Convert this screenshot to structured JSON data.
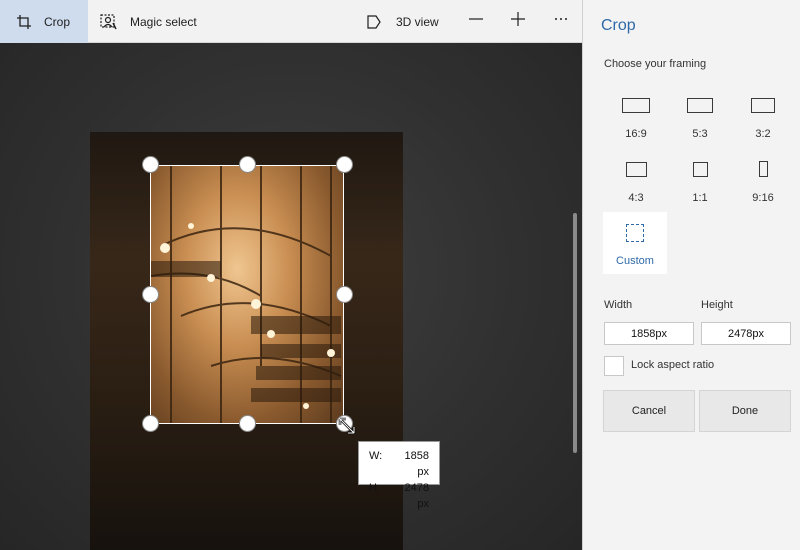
{
  "toolbar": {
    "crop_label": "Crop",
    "magic_select_label": "Magic select",
    "view_3d_label": "3D view",
    "zoom_out_icon": "minus-icon",
    "zoom_in_icon": "plus-icon",
    "more_icon": "ellipsis-icon"
  },
  "panel": {
    "title": "Crop",
    "subtitle": "Choose your framing",
    "ratios": [
      {
        "label": "16:9"
      },
      {
        "label": "5:3"
      },
      {
        "label": "3:2"
      },
      {
        "label": "4:3"
      },
      {
        "label": "1:1"
      },
      {
        "label": "9:16"
      }
    ],
    "custom_label": "Custom",
    "width_label": "Width",
    "height_label": "Height",
    "width_value": "1858px",
    "height_value": "2478px",
    "lock_label": "Lock aspect ratio",
    "cancel_label": "Cancel",
    "done_label": "Done"
  },
  "tooltip": {
    "w_key": "W:",
    "w_value": "1858 px",
    "h_key": "H:",
    "h_value": "2478 px"
  },
  "colors": {
    "accent": "#2e6aa8",
    "selected_tool_bg": "#cfdcee",
    "panel_bg": "#f3f3f3",
    "canvas_bg": "#2b2b2b"
  }
}
